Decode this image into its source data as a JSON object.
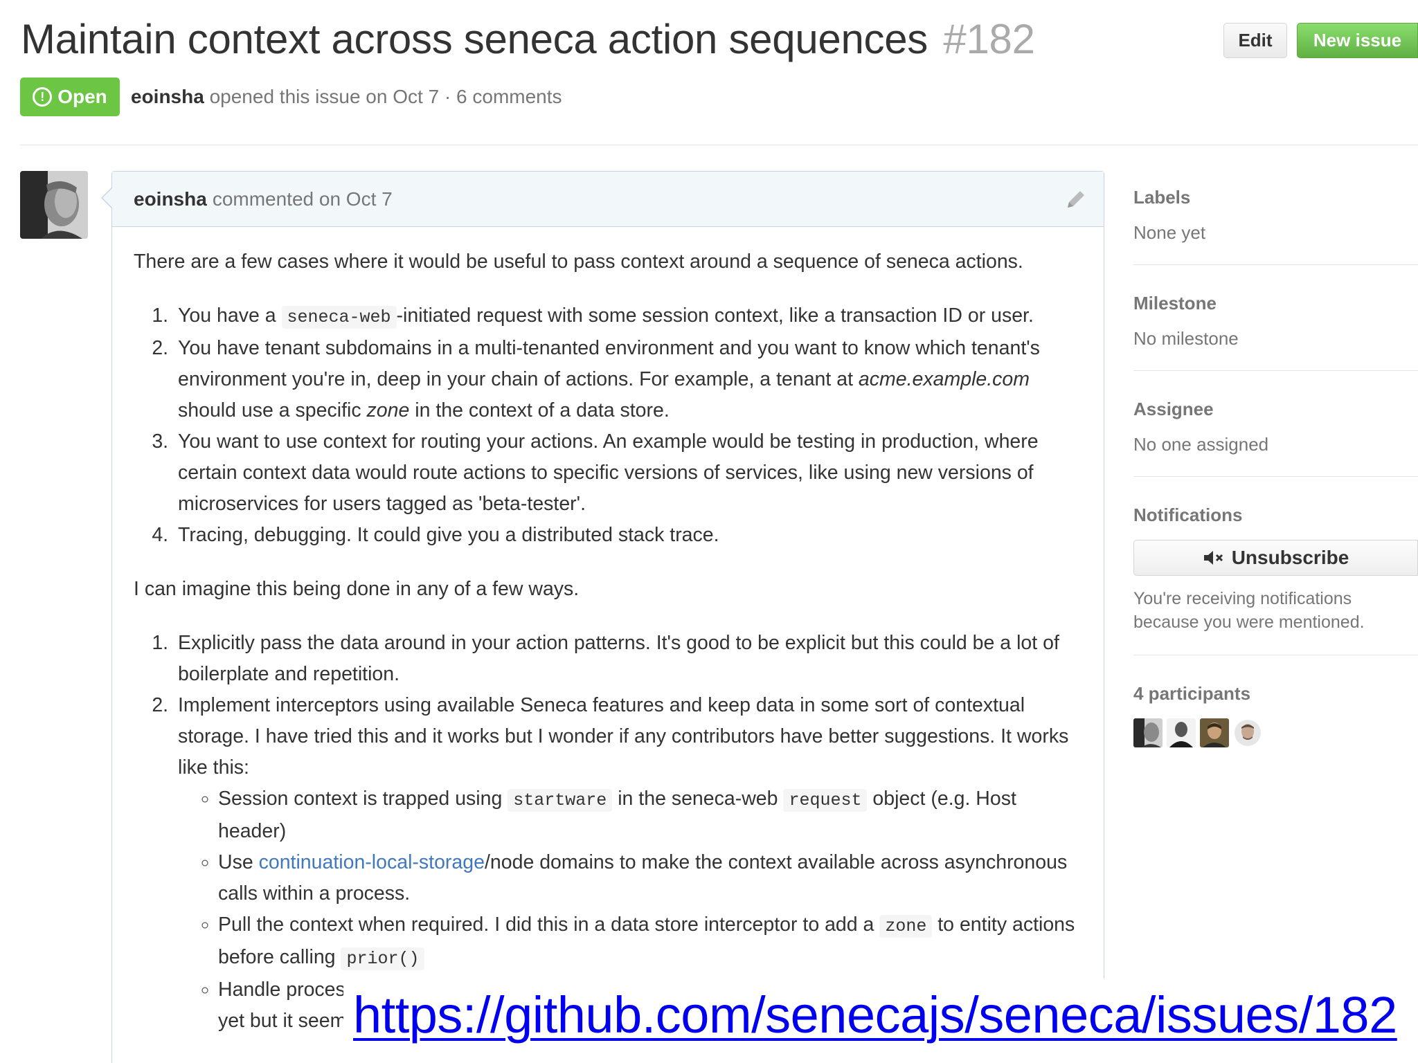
{
  "issue": {
    "title": "Maintain context across seneca action sequences",
    "number": "#182",
    "state": "Open",
    "author": "eoinsha",
    "meta": "opened this issue on Oct 7 · 6 comments"
  },
  "header_buttons": {
    "edit_label": "Edit",
    "new_issue_label": "New issue"
  },
  "comment": {
    "author": "eoinsha",
    "action": "commented on Oct 7",
    "intro": "There are a few cases where it would be useful to pass context around a sequence of seneca actions.",
    "cases": {
      "c1_a": "You have a",
      "c1_code": "seneca-web",
      "c1_b": "-initiated request with some session context, like a transaction ID or user.",
      "c2_a": "You have tenant subdomains in a multi-tenanted environment and you want to know which tenant's environment you're in, deep in your chain of actions. For example, a tenant at ",
      "c2_em1": "acme.example.com",
      "c2_b": " should use a specific ",
      "c2_em2": "zone",
      "c2_c": " in the context of a data store.",
      "c3": "You want to use context for routing your actions. An example would be testing in production, where certain context data would route actions to specific versions of services, like using new versions of microservices for users tagged as 'beta-tester'.",
      "c4": "Tracing, debugging. It could give you a distributed stack trace."
    },
    "ways_intro": "I can imagine this being done in any of a few ways.",
    "ways": {
      "w1": "Explicitly pass the data around in your action patterns. It's good to be explicit but this could be a lot of boilerplate and repetition.",
      "w2": "Implement interceptors using available Seneca features and keep data in some sort of contextual storage. I have tried this and it works but I wonder if any contributors have better suggestions. It works like this:"
    },
    "bullets": {
      "b1_a": "Session context is trapped using ",
      "b1_code1": "startware",
      "b1_b": " in the seneca-web ",
      "b1_code2": "request",
      "b1_c": " object (e.g. Host header)",
      "b2_a": "Use ",
      "b2_link": "continuation-local-storage",
      "b2_b": "/node domains to make the context available across asynchronous calls within a process.",
      "b3_a": "Pull the context when required. I did this in a data store interceptor to add a ",
      "b3_code1": "zone",
      "b3_b": " to entity actions before calling ",
      "b3_code2": "prior()",
      "b4": "Handle proces",
      "b4_cont": "yet but it seem"
    }
  },
  "sidebar": {
    "labels_heading": "Labels",
    "labels_value": "None yet",
    "milestone_heading": "Milestone",
    "milestone_value": "No milestone",
    "assignee_heading": "Assignee",
    "assignee_value": "No one assigned",
    "notifications_heading": "Notifications",
    "unsubscribe_label": "Unsubscribe",
    "notification_reason": "You're receiving notifications because you were mentioned.",
    "participants_heading": "4 participants"
  },
  "overlay": {
    "url": "https://github.com/senecajs/seneca/issues/182"
  },
  "colors": {
    "open_green": "#6cc644",
    "link_blue": "#4078c0",
    "comment_header_bg": "#f2f8fa",
    "url_blue": "#0000ee"
  },
  "icons": [
    "issue-opened-icon",
    "pencil-icon",
    "mute-icon"
  ]
}
